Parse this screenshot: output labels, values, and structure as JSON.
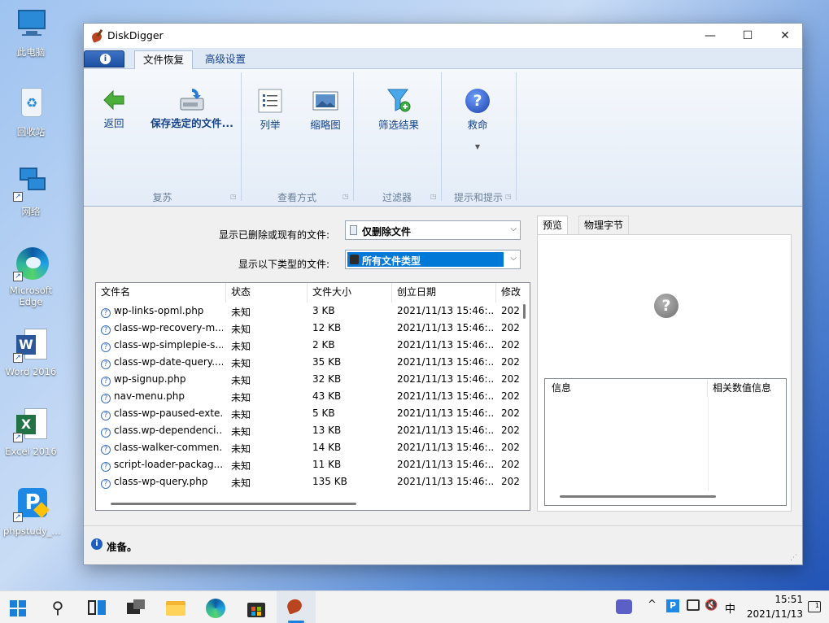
{
  "desktop": {
    "icons": [
      {
        "label": "此电脑",
        "icon": "computer-icon"
      },
      {
        "label": "回收站",
        "icon": "recycle-bin-icon"
      },
      {
        "label": "网络",
        "icon": "network-icon"
      },
      {
        "label": "Microsoft Edge",
        "icon": "edge-icon"
      },
      {
        "label": "Word 2016",
        "icon": "word-icon"
      },
      {
        "label": "Excel 2016",
        "icon": "excel-icon"
      },
      {
        "label": "phpstudy_...",
        "icon": "phpstudy-icon"
      }
    ]
  },
  "window": {
    "title": "DiskDigger",
    "controls": {
      "minimize": "—",
      "maximize": "☐",
      "close": "✕"
    }
  },
  "ribbon": {
    "tabs": [
      {
        "label": "文件恢复",
        "active": true
      },
      {
        "label": "高级设置",
        "active": false
      }
    ],
    "groups": {
      "recover": {
        "label": "复苏",
        "back": "返回",
        "save_selected": "保存选定的文件..."
      },
      "view": {
        "label": "查看方式",
        "list": "列举",
        "thumbnails": "缩略图"
      },
      "filter": {
        "label": "过滤器",
        "filter_results": "筛选结果"
      },
      "help": {
        "label": "提示和提示",
        "rescue": "救命"
      }
    }
  },
  "filters": {
    "show_deleted_label": "显示已删除或现有的文件:",
    "show_deleted_value": "仅删除文件",
    "show_types_label": "显示以下类型的文件:",
    "show_types_value": "所有文件类型"
  },
  "file_table": {
    "columns": [
      "文件名",
      "状态",
      "文件大小",
      "创立日期",
      "修改"
    ],
    "rows": [
      {
        "name": "wp-links-opml.php",
        "status": "未知",
        "size": "3 KB",
        "created": "2021/11/13 15:46:...",
        "modified": "202"
      },
      {
        "name": "class-wp-recovery-m...",
        "status": "未知",
        "size": "12 KB",
        "created": "2021/11/13 15:46:...",
        "modified": "202"
      },
      {
        "name": "class-wp-simplepie-s...",
        "status": "未知",
        "size": "2 KB",
        "created": "2021/11/13 15:46:...",
        "modified": "202"
      },
      {
        "name": "class-wp-date-query....",
        "status": "未知",
        "size": "35 KB",
        "created": "2021/11/13 15:46:...",
        "modified": "202"
      },
      {
        "name": "wp-signup.php",
        "status": "未知",
        "size": "32 KB",
        "created": "2021/11/13 15:46:...",
        "modified": "202"
      },
      {
        "name": "nav-menu.php",
        "status": "未知",
        "size": "43 KB",
        "created": "2021/11/13 15:46:...",
        "modified": "202"
      },
      {
        "name": "class-wp-paused-exte...",
        "status": "未知",
        "size": "5 KB",
        "created": "2021/11/13 15:46:...",
        "modified": "202"
      },
      {
        "name": "class.wp-dependenci...",
        "status": "未知",
        "size": "13 KB",
        "created": "2021/11/13 15:46:...",
        "modified": "202"
      },
      {
        "name": "class-walker-commen...",
        "status": "未知",
        "size": "14 KB",
        "created": "2021/11/13 15:46:...",
        "modified": "202"
      },
      {
        "name": "script-loader-packag...",
        "status": "未知",
        "size": "11 KB",
        "created": "2021/11/13 15:46:...",
        "modified": "202"
      },
      {
        "name": "class-wp-query.php",
        "status": "未知",
        "size": "135 KB",
        "created": "2021/11/13 15:46:...",
        "modified": "202"
      }
    ]
  },
  "preview": {
    "tabs": [
      "预览",
      "物理字节"
    ],
    "info_columns": [
      "信息",
      "相关数值信息"
    ]
  },
  "status": {
    "text": "准备。"
  },
  "taskbar": {
    "apps": [
      "start-icon",
      "search-icon",
      "task-view-icon",
      "widgets-icon",
      "file-explorer-icon",
      "edge-icon",
      "store-icon",
      "diskdigger-icon"
    ],
    "tray": {
      "input_method": "中",
      "time": "15:51",
      "date": "2021/11/13"
    }
  },
  "colors": {
    "accent": "#3399ff",
    "ribbon_text": "#15428b",
    "selected_combo": "#0078d7"
  }
}
